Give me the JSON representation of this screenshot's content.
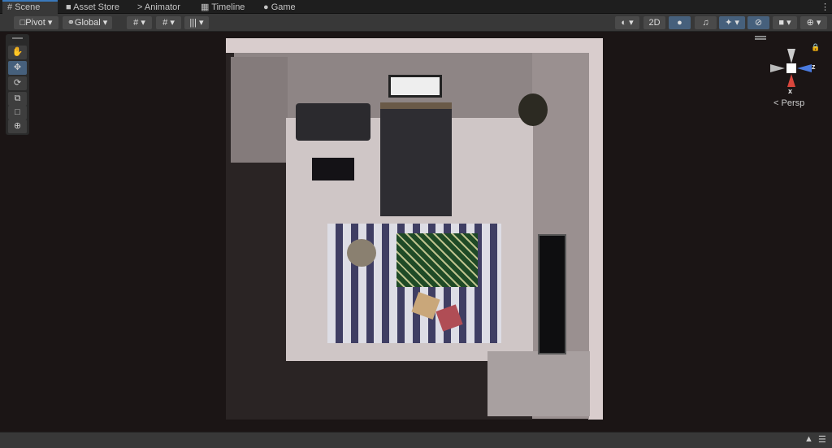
{
  "tabs": [
    {
      "label": "Scene",
      "icon": "hash-icon",
      "active": true
    },
    {
      "label": "Asset Store",
      "icon": "bag-icon"
    },
    {
      "label": "Animator",
      "icon": "animator-icon"
    },
    {
      "label": "Timeline",
      "icon": "timeline-icon"
    },
    {
      "label": "Game",
      "icon": "gamepad-icon"
    }
  ],
  "toolbar": {
    "pivot": "Pivot",
    "global": "Global",
    "mode_2d": "2D"
  },
  "gizmo": {
    "axis_z": "z",
    "axis_x": "x",
    "projection": "Persp"
  },
  "colors": {
    "accent": "#3a79bb",
    "toggle_on": "#46607c"
  }
}
